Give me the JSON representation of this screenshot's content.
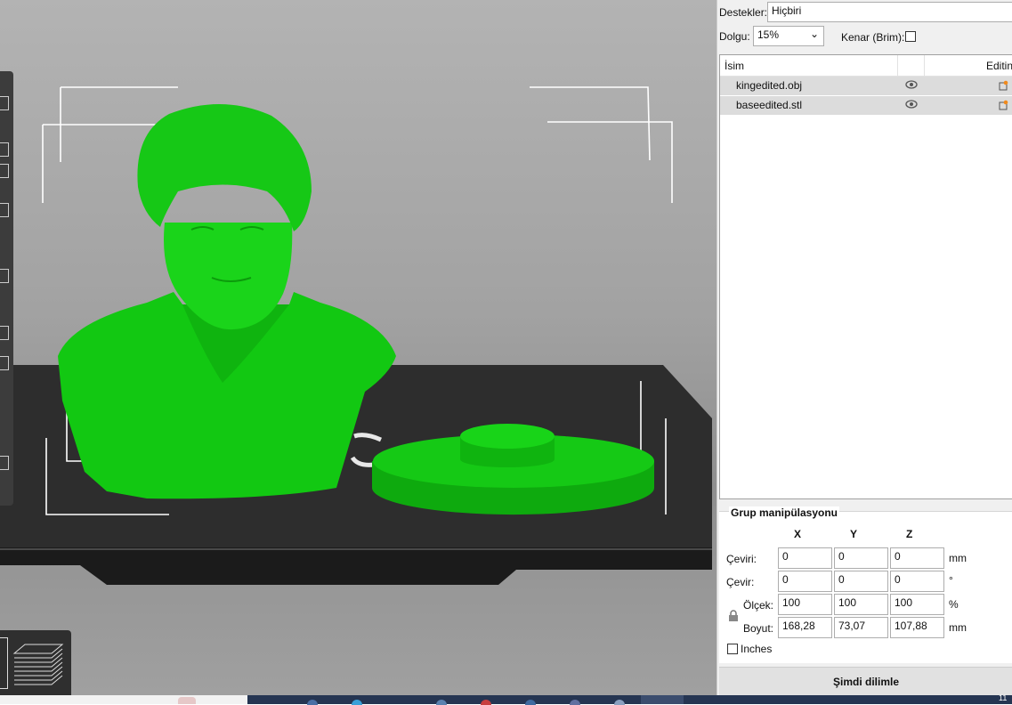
{
  "settings": {
    "supports_label": "Destekler:",
    "supports_value": "Hiçbiri",
    "infill_label": "Dolgu:",
    "infill_value": "15%",
    "brim_label": "Kenar (Brim):"
  },
  "object_list": {
    "columns": [
      "İsim",
      "",
      "Editin"
    ],
    "rows": [
      {
        "name": "kingedited.obj"
      },
      {
        "name": "baseedited.stl"
      }
    ]
  },
  "group": {
    "title": "Grup manipülasyonu",
    "axes": [
      "X",
      "Y",
      "Z"
    ],
    "rows": [
      {
        "label": "Çeviri:",
        "values": [
          "0",
          "0",
          "0"
        ],
        "unit": "mm"
      },
      {
        "label": "Çevir:",
        "values": [
          "0",
          "0",
          "0"
        ],
        "unit": "°"
      },
      {
        "label": "Ölçek:",
        "values": [
          "100",
          "100",
          "100"
        ],
        "unit": "%"
      },
      {
        "label": "Boyut:",
        "values": [
          "168,28",
          "73,07",
          "107,88"
        ],
        "unit": "mm"
      }
    ],
    "inches_label": "Inches"
  },
  "slice_button": "Şimdi dilimle",
  "taskbar": {
    "clock": "11"
  },
  "colors": {
    "model": "#14d214",
    "bed": "#2d2d2d",
    "panel": "#f0f0f0"
  }
}
